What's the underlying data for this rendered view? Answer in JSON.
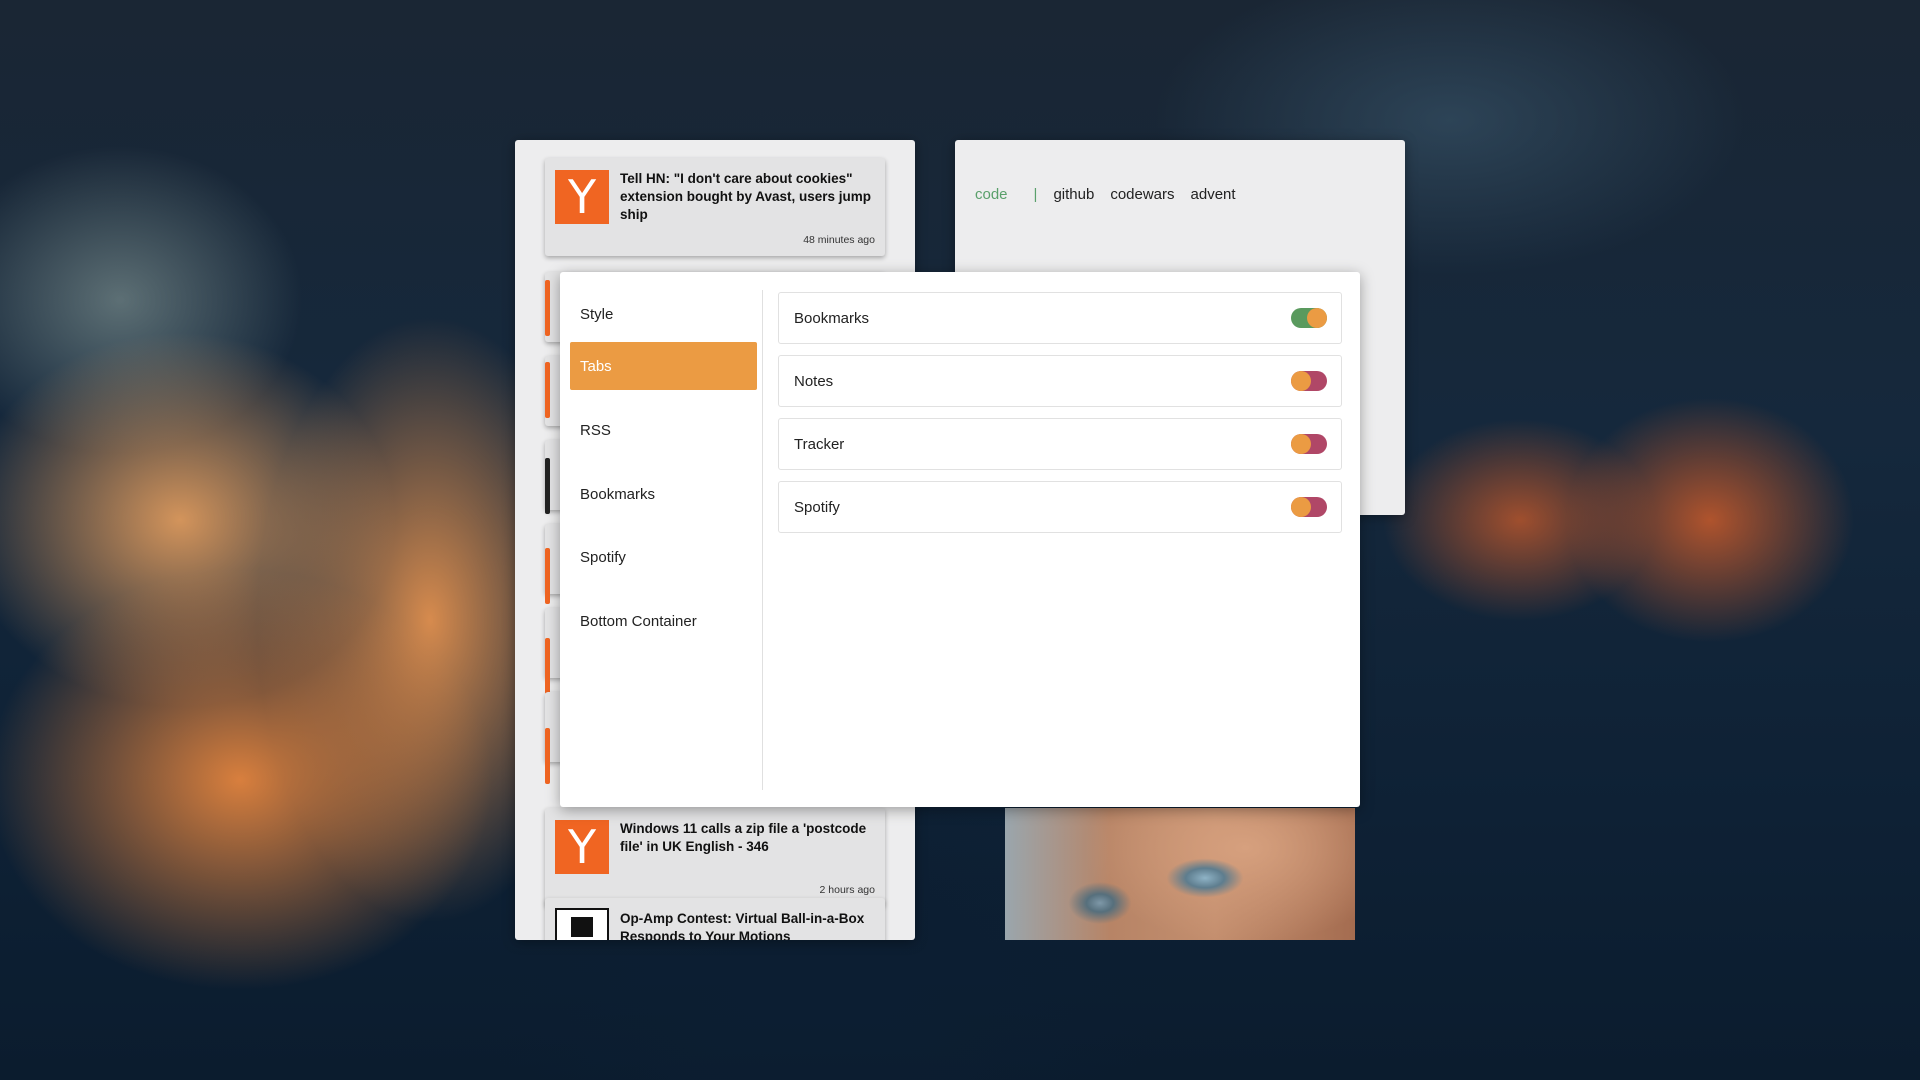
{
  "feed": {
    "cards": [
      {
        "title": "Tell HN: \"I don't care about cookies\" extension bought by Avast, users jump ship",
        "time": "48 minutes ago",
        "icon": "ycombinator-icon"
      },
      {
        "title": "Windows 11 calls a zip file a 'postcode file' in UK English - 346",
        "time": "2 hours ago",
        "icon": "ycombinator-icon"
      },
      {
        "title": "Op-Amp Contest: Virtual Ball-in-a-Box Responds to Your Motions",
        "time": "",
        "icon": "hackaday-icon"
      }
    ],
    "icon_letter": "Y"
  },
  "links": {
    "active": "code",
    "separator": "|",
    "items": [
      "github",
      "codewars",
      "advent"
    ]
  },
  "settings": {
    "menu": [
      {
        "label": "Style",
        "active": false
      },
      {
        "label": "Tabs",
        "active": true
      },
      {
        "label": "RSS",
        "active": false
      },
      {
        "label": "Bookmarks",
        "active": false
      },
      {
        "label": "Spotify",
        "active": false
      },
      {
        "label": "Bottom Container",
        "active": false
      }
    ],
    "tabs": [
      {
        "label": "Bookmarks",
        "enabled": true
      },
      {
        "label": "Notes",
        "enabled": false
      },
      {
        "label": "Tracker",
        "enabled": false
      },
      {
        "label": "Spotify",
        "enabled": false
      }
    ]
  },
  "colors": {
    "accent": "#eb9b43",
    "hn_orange": "#f06522",
    "toggle_on_track": "#5a9a5e",
    "toggle_off_track": "#b04767",
    "toggle_knob": "#eb9b43",
    "link_active": "#5aa06b"
  }
}
